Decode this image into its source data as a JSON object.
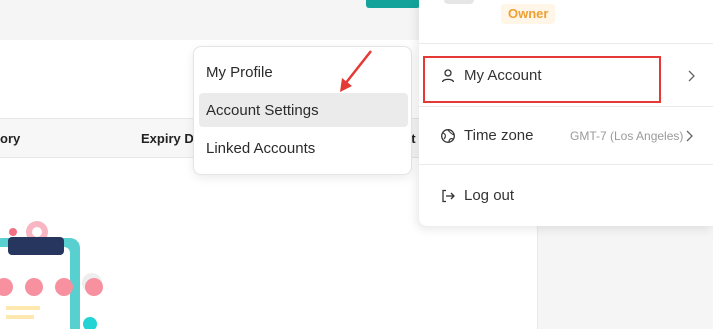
{
  "table": {
    "col_1": "ory",
    "col_2": "Expiry Da",
    "col_3": "ct"
  },
  "submenu": {
    "items": [
      {
        "label": "My Profile"
      },
      {
        "label": "Account Settings"
      },
      {
        "label": "Linked Accounts"
      }
    ]
  },
  "account_menu": {
    "owner_badge": "Owner",
    "my_account": "My Account",
    "time_zone": "Time zone",
    "time_zone_value": "GMT-7 (Los Angeles)",
    "log_out": "Log out"
  },
  "colors": {
    "accent_teal": "#13a39a",
    "owner_badge_text": "#f0a030",
    "highlight_red": "#e53935"
  }
}
